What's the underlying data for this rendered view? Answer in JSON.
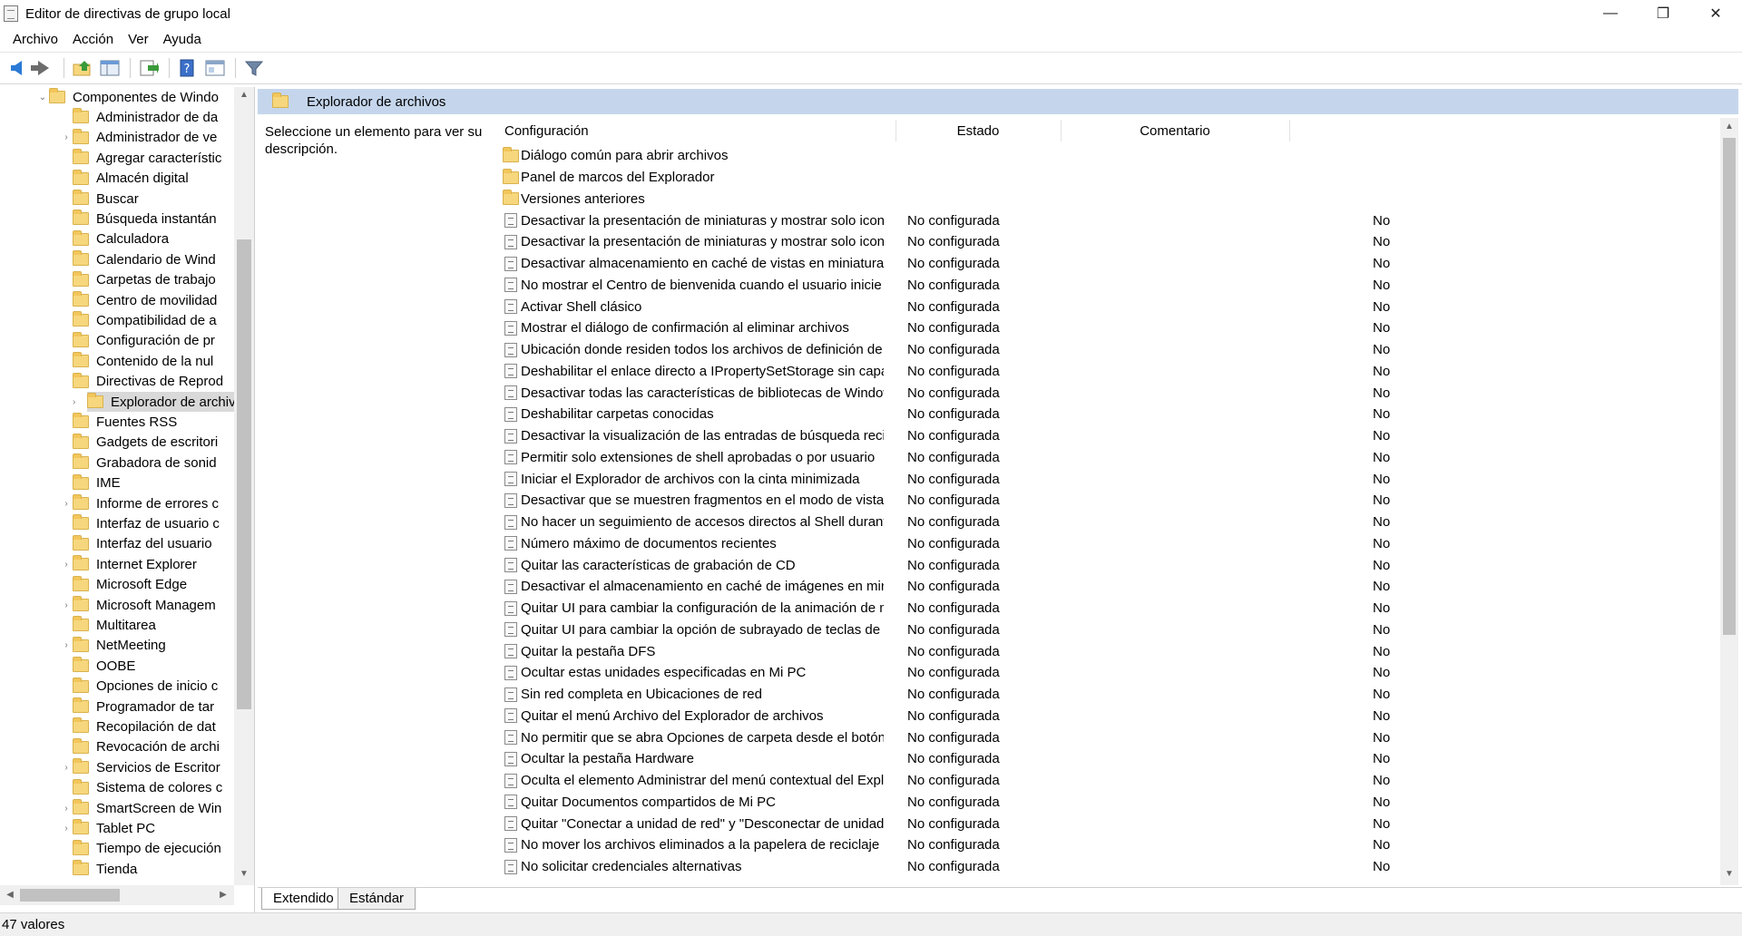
{
  "window": {
    "title": "Editor de directivas de grupo local",
    "controls": {
      "minimize": "—",
      "maximize": "❐",
      "close": "✕"
    }
  },
  "menu": [
    "Archivo",
    "Acción",
    "Ver",
    "Ayuda"
  ],
  "toolbar": {
    "icons": [
      "back-arrow-icon",
      "forward-arrow-icon",
      "up-folder-icon",
      "show-hide-tree-icon",
      "export-list-icon",
      "help-icon",
      "properties-icon",
      "filter-icon"
    ],
    "colors": {
      "back": "#2a7ad6",
      "folder": "#f7d77d",
      "help": "#3b6fc9"
    }
  },
  "tree": {
    "items": [
      {
        "label": "Componentes de Windo",
        "expander": "down",
        "level": 0
      },
      {
        "label": "Administrador de da",
        "expander": "",
        "level": 1
      },
      {
        "label": "Administrador de ve",
        "expander": "right",
        "level": 1
      },
      {
        "label": "Agregar característic",
        "expander": "",
        "level": 1
      },
      {
        "label": "Almacén digital",
        "expander": "",
        "level": 1
      },
      {
        "label": "Buscar",
        "expander": "",
        "level": 1
      },
      {
        "label": "Búsqueda instantán",
        "expander": "",
        "level": 1
      },
      {
        "label": "Calculadora",
        "expander": "",
        "level": 1
      },
      {
        "label": "Calendario de Wind",
        "expander": "",
        "level": 1
      },
      {
        "label": "Carpetas de trabajo",
        "expander": "",
        "level": 1
      },
      {
        "label": "Centro de movilidad",
        "expander": "",
        "level": 1
      },
      {
        "label": "Compatibilidad de a",
        "expander": "",
        "level": 1
      },
      {
        "label": "Configuración de pr",
        "expander": "",
        "level": 1
      },
      {
        "label": "Contenido de la nul",
        "expander": "",
        "level": 1
      },
      {
        "label": "Directivas de Reprod",
        "expander": "",
        "level": 1
      },
      {
        "label": "Explorador de archiv",
        "expander": "right",
        "level": 1,
        "selected": true
      },
      {
        "label": "Fuentes RSS",
        "expander": "",
        "level": 1
      },
      {
        "label": "Gadgets de escritori",
        "expander": "",
        "level": 1
      },
      {
        "label": "Grabadora de sonid",
        "expander": "",
        "level": 1
      },
      {
        "label": "IME",
        "expander": "",
        "level": 1
      },
      {
        "label": "Informe de errores c",
        "expander": "right",
        "level": 1
      },
      {
        "label": "Interfaz de usuario c",
        "expander": "",
        "level": 1
      },
      {
        "label": "Interfaz del usuario",
        "expander": "",
        "level": 1
      },
      {
        "label": "Internet Explorer",
        "expander": "right",
        "level": 1
      },
      {
        "label": "Microsoft Edge",
        "expander": "",
        "level": 1
      },
      {
        "label": "Microsoft Managem",
        "expander": "right",
        "level": 1
      },
      {
        "label": "Multitarea",
        "expander": "",
        "level": 1
      },
      {
        "label": "NetMeeting",
        "expander": "right",
        "level": 1
      },
      {
        "label": "OOBE",
        "expander": "",
        "level": 1
      },
      {
        "label": "Opciones de inicio c",
        "expander": "",
        "level": 1
      },
      {
        "label": "Programador de tar",
        "expander": "",
        "level": 1
      },
      {
        "label": "Recopilación de dat",
        "expander": "",
        "level": 1
      },
      {
        "label": "Revocación de archi",
        "expander": "",
        "level": 1
      },
      {
        "label": "Servicios de Escritor",
        "expander": "right",
        "level": 1
      },
      {
        "label": "Sistema de colores c",
        "expander": "",
        "level": 1
      },
      {
        "label": "SmartScreen de Win",
        "expander": "right",
        "level": 1
      },
      {
        "label": "Tablet PC",
        "expander": "right",
        "level": 1
      },
      {
        "label": "Tiempo de ejecución",
        "expander": "",
        "level": 1
      },
      {
        "label": "Tienda",
        "expander": "",
        "level": 1
      }
    ]
  },
  "pane": {
    "title": "Explorador de archivos",
    "description": "Seleccione un elemento para ver su descripción.",
    "columns": {
      "name": "Configuración",
      "state": "Estado",
      "comment": "Comentario"
    },
    "folders": [
      "Diálogo común para abrir archivos",
      "Panel de marcos del Explorador",
      "Versiones anteriores"
    ],
    "settings": [
      {
        "name": "Desactivar la presentación de miniaturas y mostrar solo iconos",
        "state": "No configurada",
        "comment": "No"
      },
      {
        "name": "Desactivar la presentación de miniaturas y mostrar solo icono...",
        "state": "No configurada",
        "comment": "No"
      },
      {
        "name": "Desactivar almacenamiento en caché de vistas en miniatura e...",
        "state": "No configurada",
        "comment": "No"
      },
      {
        "name": "No mostrar el Centro de bienvenida cuando el usuario inicie ...",
        "state": "No configurada",
        "comment": "No"
      },
      {
        "name": "Activar Shell clásico",
        "state": "No configurada",
        "comment": "No"
      },
      {
        "name": "Mostrar el diálogo de confirmación al eliminar archivos",
        "state": "No configurada",
        "comment": "No"
      },
      {
        "name": "Ubicación donde residen todos los archivos de definición de ...",
        "state": "No configurada",
        "comment": "No"
      },
      {
        "name": "Deshabilitar el enlace directo a IPropertySetStorage sin capas ...",
        "state": "No configurada",
        "comment": "No"
      },
      {
        "name": "Desactivar todas las características de bibliotecas de Windows...",
        "state": "No configurada",
        "comment": "No"
      },
      {
        "name": "Deshabilitar carpetas conocidas",
        "state": "No configurada",
        "comment": "No"
      },
      {
        "name": "Desactivar la visualización de las entradas de búsqueda recie...",
        "state": "No configurada",
        "comment": "No"
      },
      {
        "name": "Permitir solo extensiones de shell aprobadas o por usuario",
        "state": "No configurada",
        "comment": "No"
      },
      {
        "name": "Iniciar el Explorador de archivos con la cinta minimizada",
        "state": "No configurada",
        "comment": "No"
      },
      {
        "name": "Desactivar que se muestren fragmentos en el modo de vista ...",
        "state": "No configurada",
        "comment": "No"
      },
      {
        "name": "No hacer un seguimiento de accesos directos al Shell durante...",
        "state": "No configurada",
        "comment": "No"
      },
      {
        "name": "Número máximo de documentos recientes",
        "state": "No configurada",
        "comment": "No"
      },
      {
        "name": "Quitar las características de grabación de CD",
        "state": "No configurada",
        "comment": "No"
      },
      {
        "name": "Desactivar el almacenamiento en caché de imágenes en mini...",
        "state": "No configurada",
        "comment": "No"
      },
      {
        "name": "Quitar UI para cambiar la configuración de la animación de m...",
        "state": "No configurada",
        "comment": "No"
      },
      {
        "name": "Quitar UI para cambiar la opción de subrayado de teclas de a...",
        "state": "No configurada",
        "comment": "No"
      },
      {
        "name": "Quitar la pestaña DFS",
        "state": "No configurada",
        "comment": "No"
      },
      {
        "name": "Ocultar estas unidades especificadas en Mi PC",
        "state": "No configurada",
        "comment": "No"
      },
      {
        "name": "Sin red completa en Ubicaciones de red",
        "state": "No configurada",
        "comment": "No"
      },
      {
        "name": "Quitar el menú Archivo del Explorador de archivos",
        "state": "No configurada",
        "comment": "No"
      },
      {
        "name": "No permitir que se abra Opciones de carpeta desde el botón ...",
        "state": "No configurada",
        "comment": "No"
      },
      {
        "name": "Ocultar la pestaña Hardware",
        "state": "No configurada",
        "comment": "No"
      },
      {
        "name": "Oculta el elemento Administrar del menú contextual del Expl...",
        "state": "No configurada",
        "comment": "No"
      },
      {
        "name": "Quitar Documentos compartidos de Mi PC",
        "state": "No configurada",
        "comment": "No"
      },
      {
        "name": "Quitar \"Conectar a unidad de red\" y \"Desconectar de unidad ...",
        "state": "No configurada",
        "comment": "No"
      },
      {
        "name": "No mover los archivos eliminados a la papelera de reciclaje",
        "state": "No configurada",
        "comment": "No"
      },
      {
        "name": "No solicitar credenciales alternativas",
        "state": "No configurada",
        "comment": "No"
      }
    ]
  },
  "tabs": [
    "Extendido",
    "Estándar"
  ],
  "status": "47 valores",
  "colors": {
    "header_bar": "#c5d6ec",
    "tree_selected": "#d9d9d9"
  }
}
